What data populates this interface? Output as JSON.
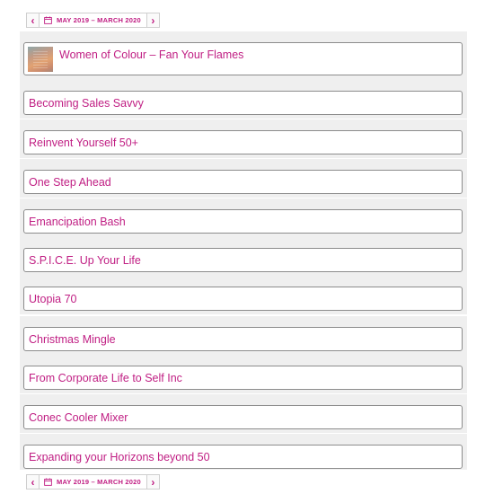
{
  "date_range": {
    "top_label": "MAY 2019 – MARCH 2020",
    "bottom_label": "MAY 2019 – MARCH 2020",
    "prev_icon": "chevron-left-icon",
    "next_icon": "chevron-right-icon",
    "calendar_icon": "calendar-icon"
  },
  "events": [
    {
      "title": "Women of Colour – Fan Your Flames",
      "has_thumbnail": true
    },
    {
      "title": "Becoming Sales Savvy"
    },
    {
      "title": "Reinvent Yourself 50+"
    },
    {
      "title": "One Step Ahead"
    },
    {
      "title": "Emancipation Bash"
    },
    {
      "title": "S.P.I.C.E. Up Your Life"
    },
    {
      "title": "Utopia 70"
    },
    {
      "title": "Christmas Mingle"
    },
    {
      "title": "From Corporate Life to Self Inc"
    },
    {
      "title": "Conec Cooler Mixer"
    },
    {
      "title": "Expanding your Horizons beyond 50"
    }
  ],
  "colors": {
    "accent": "#c01e83",
    "card_border": "#8c8c8c",
    "band_background": "#efefef"
  }
}
